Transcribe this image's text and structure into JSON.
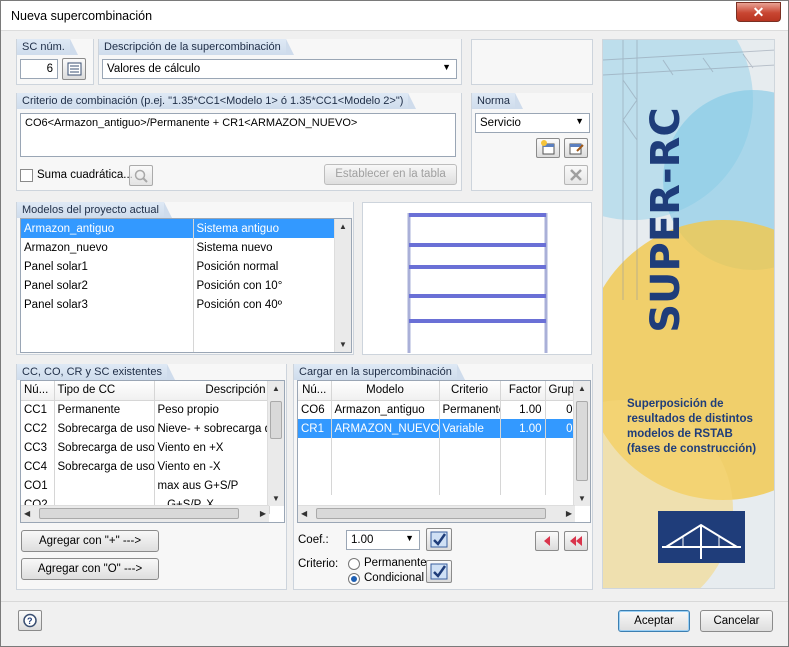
{
  "window": {
    "title": "Nueva supercombinación",
    "close": "✕"
  },
  "sc": {
    "label": "SC núm.",
    "value": "6"
  },
  "desc": {
    "label": "Descripción de la supercombinación",
    "value": "Valores de cálculo"
  },
  "criterio": {
    "label": "Criterio de combinación (p.ej. \"1.35*CC1<Modelo 1> ó 1.35*CC1<Modelo 2>\")",
    "value": "CO6<Armazon_antiguo>/Permanente + CR1<ARMAZON_NUEVO>",
    "suma": "Suma cuadrática...",
    "establecer": "Establecer en la tabla"
  },
  "norma": {
    "label": "Norma",
    "value": "Servicio"
  },
  "modelos": {
    "label": "Modelos del proyecto actual",
    "rows": [
      [
        "Armazon_antiguo",
        "Sistema antiguo"
      ],
      [
        "Armazon_nuevo",
        "Sistema nuevo"
      ],
      [
        "Panel solar1",
        "Posición normal"
      ],
      [
        "Panel solar2",
        "Posición con 10°"
      ],
      [
        "Panel solar3",
        "Posición con 40º"
      ]
    ]
  },
  "cc": {
    "label": "CC, CO, CR y SC existentes",
    "headers": [
      "Nú...",
      "Tipo de CC",
      "Descripción"
    ],
    "rows": [
      [
        "CC1",
        "Permanente",
        "Peso propio"
      ],
      [
        "CC2",
        "Sobrecarga de uso",
        "Nieve- + sobrecarga de"
      ],
      [
        "CC3",
        "Sobrecarga de uso",
        "Viento en +X"
      ],
      [
        "CC4",
        "Sobrecarga de uso",
        "Viento en -X"
      ],
      [
        "CO1",
        "",
        "max aus G+S/P"
      ],
      [
        "CO2",
        "",
        "...G+S/P..X"
      ]
    ],
    "add_plus": "Agregar con \"+\" --->",
    "add_o": "Agregar con \"O\" --->"
  },
  "cargar": {
    "label": "Cargar en la supercombinación",
    "headers": [
      "Nú...",
      "Modelo",
      "Criterio",
      "Factor",
      "Grup"
    ],
    "rows": [
      [
        "CO6",
        "Armazon_antiguo",
        "Permanente",
        "1.00",
        "0"
      ],
      [
        "CR1",
        "ARMAZON_NUEVO",
        "Variable",
        "1.00",
        "0"
      ]
    ],
    "coef_label": "Coef.:",
    "coef_value": "1.00",
    "crit_label": "Criterio:",
    "opt1": "Permanente",
    "opt2": "Condicional"
  },
  "brand": {
    "name": "SUPER-RC",
    "desc": "Superposición de resultados de distintos modelos de RSTAB (fases de construcción)"
  },
  "footer": {
    "accept": "Aceptar",
    "cancel": "Cancelar"
  },
  "colors": {
    "accent": "#3399ff",
    "brand_blue": "#1f3d7a",
    "brand_yellow": "#f3c84a",
    "brand_cyan": "#8fd3ec"
  }
}
